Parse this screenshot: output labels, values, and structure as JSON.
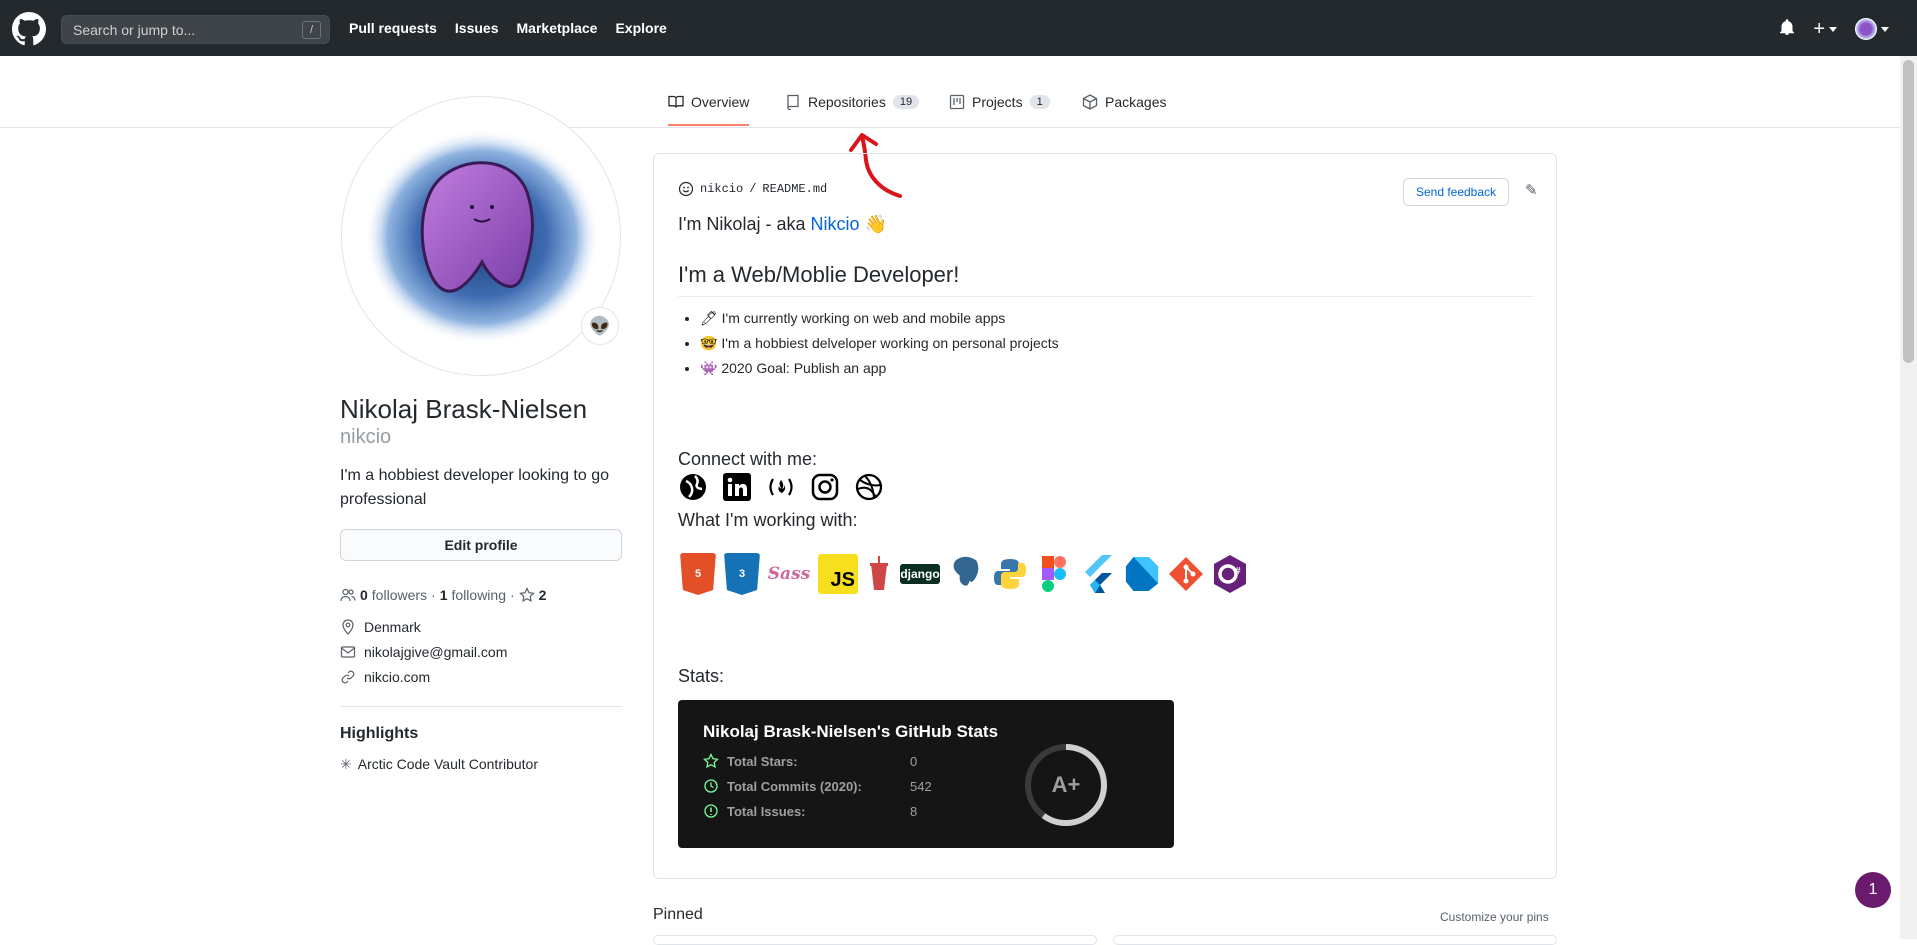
{
  "header": {
    "search_placeholder": "Search or jump to...",
    "search_shortcut": "/",
    "nav": [
      "Pull requests",
      "Issues",
      "Marketplace",
      "Explore"
    ],
    "icons": [
      "bell-icon",
      "plus-icon",
      "avatar-icon"
    ]
  },
  "tabs": [
    {
      "label": "Overview",
      "icon": "book-icon",
      "active": true
    },
    {
      "label": "Repositories",
      "count": "19",
      "icon": "repo-icon"
    },
    {
      "label": "Projects",
      "count": "1",
      "icon": "project-icon"
    },
    {
      "label": "Packages",
      "icon": "package-icon"
    }
  ],
  "profile": {
    "name": "Nikolaj Brask-Nielsen",
    "username": "nikcio",
    "bio": "I'm a hobbiest developer looking to go professional",
    "edit_label": "Edit profile",
    "followers_count": "0",
    "followers_label": "followers",
    "following_count": "1",
    "following_label": "following",
    "stars_count": "2",
    "location": "Denmark",
    "email": "nikolajgive@gmail.com",
    "website": "nikcio.com",
    "highlights_title": "Highlights",
    "highlight_item": "Arctic Code Vault Contributor",
    "status_emoji": "👽"
  },
  "readme": {
    "path_user": "nikcio",
    "path_sep": "/",
    "path_file": "README.md",
    "send_feedback": "Send feedback",
    "intro_prefix": "I'm Nikolaj - aka ",
    "intro_link": "Nikcio",
    "intro_emoji": "👋",
    "heading": "I'm a Web/Moblie Developer!",
    "list": [
      {
        "emoji": "🖊",
        "text": "I'm currently working on web and mobile apps"
      },
      {
        "emoji": "🤓",
        "text": "I'm a hobbiest delveloper working on personal projects"
      },
      {
        "emoji": "👾",
        "text": "2020 Goal: Publish an app"
      }
    ],
    "connect_title": "Connect with me:",
    "connect_icons": [
      "globe-icon",
      "linkedin-icon",
      "freecodecamp-icon",
      "instagram-icon",
      "dribbble-icon"
    ],
    "working_title": "What I'm working with:",
    "tech": [
      {
        "name": "HTML",
        "color": "#e34f26"
      },
      {
        "name": "CSS",
        "color": "#1572b6"
      },
      {
        "name": "Sass",
        "color": "#cd6799"
      },
      {
        "name": "JS",
        "color": "#f7df1e"
      },
      {
        "name": "Gulp",
        "color": "#cf4647"
      },
      {
        "name": "django",
        "color": "#092e20"
      },
      {
        "name": "PostgreSQL",
        "color": "#336791"
      },
      {
        "name": "Python",
        "color": "#3776ab"
      },
      {
        "name": "Figma",
        "color": "#f24e1e"
      },
      {
        "name": "Flutter",
        "color": "#02569b"
      },
      {
        "name": "Dart",
        "color": "#0175c2"
      },
      {
        "name": "Git",
        "color": "#f05032"
      },
      {
        "name": "C#",
        "color": "#68217a"
      }
    ],
    "stats_title": "Stats:"
  },
  "stats_card": {
    "title": "Nikolaj Brask-Nielsen's GitHub Stats",
    "rows": [
      {
        "label": "Total Stars:",
        "value": "0",
        "icon": "star-icon"
      },
      {
        "label": "Total Commits (2020):",
        "value": "542",
        "icon": "history-icon"
      },
      {
        "label": "Total Issues:",
        "value": "8",
        "icon": "issue-icon"
      }
    ],
    "grade": "A+",
    "grade_progress": 0.6
  },
  "pinned": {
    "title": "Pinned",
    "customize": "Customize your pins"
  },
  "fab_count": "1",
  "colors": {
    "header_bg": "#24292e",
    "link": "#0366d6",
    "tab_active": "#f9826c",
    "stats_bg": "#151515",
    "annotation": "#d9141b"
  }
}
